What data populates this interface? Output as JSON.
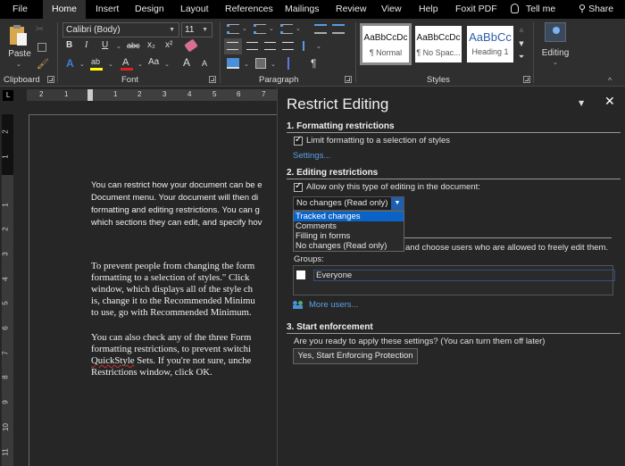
{
  "menu_tabs": [
    {
      "label": "File"
    },
    {
      "label": "Home"
    },
    {
      "label": "Insert"
    },
    {
      "label": "Design"
    },
    {
      "label": "Layout"
    },
    {
      "label": "References"
    },
    {
      "label": "Mailings"
    },
    {
      "label": "Review"
    },
    {
      "label": "View"
    },
    {
      "label": "Help"
    },
    {
      "label": "Foxit PDF"
    }
  ],
  "active_tab": "Home",
  "tell_me": "Tell me",
  "share": "Share",
  "ribbon": {
    "clipboard": {
      "paste_label": "Paste",
      "group_label": "Clipboard"
    },
    "font": {
      "font_name": "Calibri (Body)",
      "font_size": "11",
      "bold": "B",
      "italic": "I",
      "underline": "U",
      "strikethrough": "abc",
      "subscript": "x₂",
      "superscript": "x²",
      "change_case": "Aa",
      "grow": "A",
      "shrink": "A",
      "highlight_color": "#ffff00",
      "font_color": "#e02020",
      "group_label": "Font"
    },
    "paragraph": {
      "group_label": "Paragraph",
      "pilcrow": "¶"
    },
    "styles": {
      "group_label": "Styles",
      "items": [
        {
          "sample": "AaBbCcDc",
          "name": "¶ Normal"
        },
        {
          "sample": "AaBbCcDc",
          "name": "¶ No Spac..."
        },
        {
          "sample": "AaBbCc",
          "name": "Heading 1"
        }
      ]
    },
    "editing": {
      "label": "Editing"
    }
  },
  "ruler": {
    "tab_selector": "L",
    "h_numbers": [
      "2",
      "1",
      "1",
      "2",
      "3",
      "4",
      "5",
      "6",
      "7"
    ],
    "v_numbers": [
      "2",
      "1",
      "1",
      "2",
      "3",
      "4",
      "5",
      "6",
      "7",
      "8",
      "9",
      "10",
      "11"
    ]
  },
  "document": {
    "para1": [
      "You can restrict how your document can be e",
      "Document menu. Your document will then di",
      "formatting and editing restrictions. You can g",
      "which sections they can edit, and specify hov"
    ],
    "para2": [
      "To prevent people from changing the form",
      "formatting to a selection of styles.\" Click",
      "window, which displays all of the style ch",
      "is, change it to the Recommended Minimu",
      "to use, go with Recommended Minimum."
    ],
    "para3_line1": "You can also check any of the three Form",
    "para3_line2": "formatting restrictions, to prevent switchi",
    "para3_line3_misspelled": "QuickStyle",
    "para3_line3_rest": " Sets. If you're not sure, unche",
    "para3_line4": "Restrictions window, click OK."
  },
  "pane": {
    "title": "Restrict Editing",
    "section1": {
      "heading": "1. Formatting restrictions",
      "checkbox_label": "Limit formatting to a selection of styles",
      "checked": true,
      "settings_link": "Settings..."
    },
    "section2": {
      "heading": "2. Editing restrictions",
      "checkbox_label": "Allow only this type of editing in the document:",
      "checked": true,
      "dropdown_value": "No changes (Read only)",
      "dropdown_options": [
        "Tracked changes",
        "Comments",
        "Filling in forms",
        "No changes (Read only)"
      ],
      "highlighted_option": "Tracked changes",
      "exceptions_text": "and choose users who are allowed to freely edit them.",
      "groups_label": "Groups:",
      "group_item": "Everyone",
      "group_checked": false,
      "more_users": "More users..."
    },
    "section3": {
      "heading": "3. Start enforcement",
      "question": "Are you ready to apply these settings? (You can turn them off later)",
      "button": "Yes, Start Enforcing Protection"
    }
  }
}
